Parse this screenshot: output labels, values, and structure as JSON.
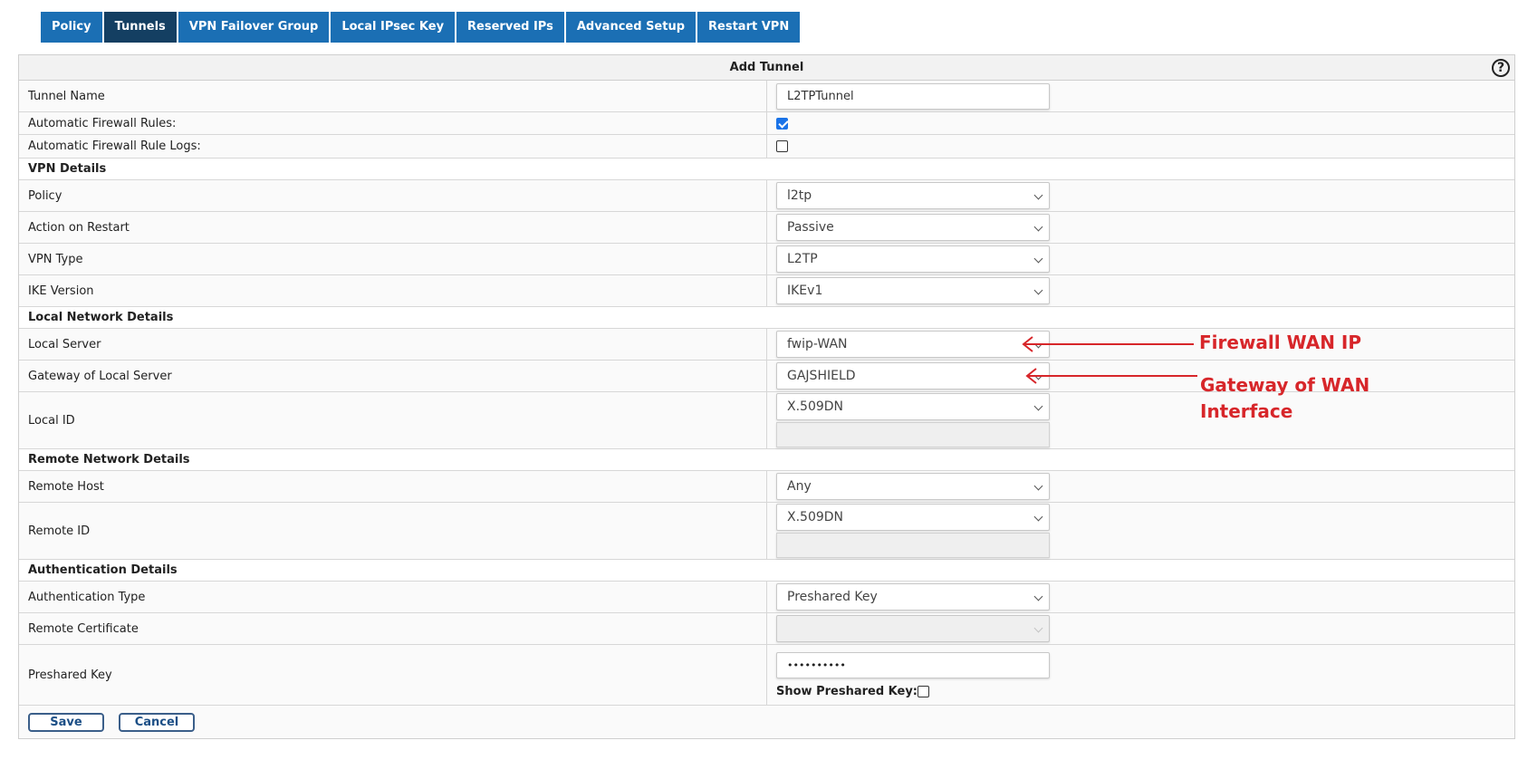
{
  "tabs": [
    {
      "label": "Policy",
      "active": false
    },
    {
      "label": "Tunnels",
      "active": true
    },
    {
      "label": "VPN Failover Group",
      "active": false
    },
    {
      "label": "Local IPsec Key",
      "active": false
    },
    {
      "label": "Reserved IPs",
      "active": false
    },
    {
      "label": "Advanced Setup",
      "active": false
    },
    {
      "label": "Restart VPN",
      "active": false
    }
  ],
  "panel": {
    "title": "Add Tunnel",
    "help_icon": "?"
  },
  "basic": {
    "tunnel_name_label": "Tunnel Name",
    "tunnel_name_value": "L2TPTunnel",
    "auto_fw_rules_label": "Automatic Firewall Rules:",
    "auto_fw_rules_checked": true,
    "auto_fw_logs_label": "Automatic Firewall Rule Logs:",
    "auto_fw_logs_checked": false
  },
  "vpn_details": {
    "section_title": "VPN Details",
    "policy_label": "Policy",
    "policy_value": "l2tp",
    "action_label": "Action on Restart",
    "action_value": "Passive",
    "type_label": "VPN Type",
    "type_value": "L2TP",
    "ike_label": "IKE Version",
    "ike_value": "IKEv1"
  },
  "local_network": {
    "section_title": "Local Network Details",
    "server_label": "Local Server",
    "server_value": "fwip-WAN",
    "gateway_label": "Gateway of Local Server",
    "gateway_value": "GAJSHIELD",
    "local_id_label": "Local ID",
    "local_id_value": "X.509DN"
  },
  "remote_network": {
    "section_title": "Remote Network Details",
    "host_label": "Remote Host",
    "host_value": "Any",
    "remote_id_label": "Remote ID",
    "remote_id_value": "X.509DN"
  },
  "auth": {
    "section_title": "Authentication Details",
    "type_label": "Authentication Type",
    "type_value": "Preshared Key",
    "cert_label": "Remote Certificate",
    "cert_value": "",
    "psk_label": "Preshared Key",
    "psk_value": "••••••••••",
    "show_psk_label": "Show Preshared Key:",
    "show_psk_checked": false
  },
  "buttons": {
    "save": "Save",
    "cancel": "Cancel"
  },
  "annotations": {
    "wan_ip": "Firewall WAN IP",
    "gateway_line1": "Gateway of WAN",
    "gateway_line2": "Interface",
    "color": "#d7262a"
  },
  "colors": {
    "tab_bg": "#1b6fb4",
    "tab_active_bg": "#143f62",
    "checkbox_accent": "#1a73e8"
  }
}
